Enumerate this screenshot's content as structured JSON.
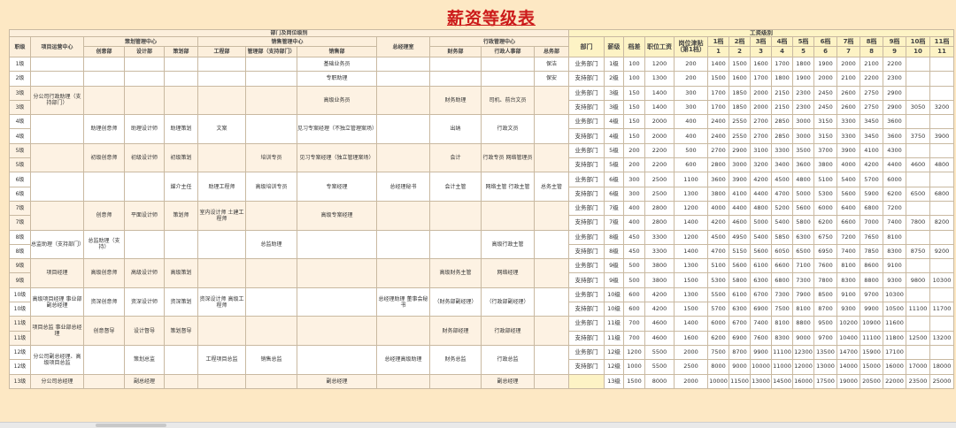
{
  "title": "薪资等级表",
  "left": {
    "group_header": "部门及岗位级别",
    "col_level": "职级",
    "col_xm": "项目运营中心",
    "col_zlb": "总经理室",
    "centers": [
      {
        "name": "策划管理中心",
        "depts": [
          "创意部",
          "设计部",
          "策划部"
        ]
      },
      {
        "name": "销售管理中心",
        "depts": [
          "工程部",
          "管理部（支持部门）",
          "销售部"
        ]
      },
      {
        "name": "行政管理中心",
        "depts": [
          "财务部",
          "行政人事部",
          "总务部"
        ]
      }
    ],
    "rows": [
      {
        "lv": "1级",
        "c": [
          "",
          "",
          "",
          "",
          "",
          "",
          "基础业务员",
          "",
          "",
          "",
          "保洁"
        ]
      },
      {
        "lv": "2级",
        "c": [
          "",
          "",
          "",
          "",
          "",
          "",
          "专职助理",
          "",
          "",
          "",
          "保安"
        ]
      },
      {
        "lv": "3级",
        "c": [
          "",
          "",
          "",
          "",
          "",
          "",
          "",
          "",
          "",
          "",
          ""
        ]
      },
      {
        "lv": "3级",
        "c": [
          "分公司行政助理（支持部门）",
          "",
          "",
          "",
          "",
          "",
          "高级业务员",
          "",
          "财务助理",
          "司机、前台文员",
          ""
        ]
      },
      {
        "lv": "4级",
        "c": [
          "",
          "",
          "",
          "",
          "",
          "",
          "",
          "",
          "",
          "",
          ""
        ]
      },
      {
        "lv": "4级",
        "c": [
          "",
          "助理创意师",
          "助理设计师",
          "助理策划",
          "文案",
          "",
          "见习专案经理（不独立管理案场）",
          "",
          "出纳",
          "行政文员",
          ""
        ]
      },
      {
        "lv": "5级",
        "c": [
          "",
          "",
          "",
          "",
          "",
          "",
          "",
          "",
          "",
          "",
          ""
        ]
      },
      {
        "lv": "5级",
        "c": [
          "",
          "初级创意师",
          "初级设计师",
          "初级策划",
          "",
          "培训专员",
          "见习专案经理（独立管理案场）",
          "",
          "会计",
          "行政专员 网络管理员",
          ""
        ]
      },
      {
        "lv": "6级",
        "c": [
          "",
          "",
          "",
          "",
          "",
          "",
          "",
          "",
          "",
          "",
          ""
        ]
      },
      {
        "lv": "6级",
        "c": [
          "",
          "",
          "",
          "媒介主任",
          "助理工程师",
          "高级培训专员",
          "专案经理",
          "总经理秘书",
          "会计主管",
          "网络主管 行政主管",
          "总务主管"
        ]
      },
      {
        "lv": "7级",
        "c": [
          "",
          "",
          "",
          "",
          "",
          "",
          "",
          "",
          "",
          "",
          ""
        ]
      },
      {
        "lv": "7级",
        "c": [
          "",
          "创意师",
          "平面设计师",
          "策划师",
          "室内设计师 土建工程师",
          "",
          "高级专案经理",
          "",
          "",
          "",
          ""
        ]
      },
      {
        "lv": "8级",
        "c": [
          "",
          "",
          "",
          "",
          "",
          "",
          "",
          "",
          "",
          "",
          ""
        ]
      },
      {
        "lv": "8级",
        "c": [
          "总监助理（支持部门）",
          "总监助理（支持）",
          "",
          "",
          "",
          "总监助理",
          "",
          "",
          "",
          "高级行政主管",
          ""
        ]
      },
      {
        "lv": "9级",
        "c": [
          "",
          "",
          "",
          "",
          "",
          "",
          "",
          "",
          "",
          "",
          ""
        ]
      },
      {
        "lv": "9级",
        "c": [
          "项目经理",
          "高级创意师",
          "高级设计师",
          "高级策划",
          "",
          "",
          "",
          "",
          "高级财务主管",
          "网络经理",
          ""
        ]
      },
      {
        "lv": "10级",
        "c": [
          "",
          "",
          "",
          "",
          "",
          "",
          "",
          "",
          "",
          "",
          ""
        ]
      },
      {
        "lv": "10级",
        "c": [
          "高级项目经理 事业部副总经理",
          "资深创意师",
          "资深设计师",
          "资深策划",
          "资深设计师 高级工程师",
          "",
          "",
          "总经理助理 董事会秘书",
          "（财务部副经理）",
          "（行政部副经理）",
          ""
        ]
      },
      {
        "lv": "11级",
        "c": [
          "",
          "",
          "",
          "",
          "",
          "",
          "",
          "",
          "",
          "",
          ""
        ]
      },
      {
        "lv": "11级",
        "c": [
          "项目总监 事业部总经理",
          "创意督导",
          "设计督导",
          "策划督导",
          "",
          "",
          "",
          "",
          "财务部经理",
          "行政部经理",
          ""
        ]
      },
      {
        "lv": "12级",
        "c": [
          "",
          "",
          "",
          "",
          "",
          "",
          "",
          "",
          "",
          "",
          ""
        ]
      },
      {
        "lv": "12级",
        "c": [
          "分公司副总经理、高级项目总监",
          "",
          "策划总监",
          "",
          "工程项目总监",
          "销售总监",
          "",
          "总经理高级助理",
          "财务总监",
          "行政总监",
          ""
        ]
      },
      {
        "lv": "13级",
        "c": [
          "分公司总经理",
          "",
          "副总经理",
          "",
          "",
          "",
          "副总经理",
          "",
          "",
          "副总经理",
          ""
        ]
      }
    ]
  },
  "right": {
    "group_header": "工资级别",
    "headers": {
      "dept": "部门",
      "level": "薪级",
      "diff": "档差",
      "base": "职位工资",
      "post": "岗位津贴（第1档）",
      "grades": [
        "1档",
        "2档",
        "3档",
        "4档",
        "5档",
        "6档",
        "7档",
        "8档",
        "9档",
        "10档",
        "11档"
      ],
      "nums": [
        "1",
        "2",
        "3",
        "4",
        "5",
        "6",
        "7",
        "8",
        "9",
        "10",
        "11"
      ]
    },
    "rows": [
      {
        "d": "业务部门",
        "lv": "1级",
        "diff": "100",
        "base": "1200",
        "post": "200",
        "g": [
          "1400",
          "1500",
          "1600",
          "1700",
          "1800",
          "1900",
          "2000",
          "2100",
          "2200",
          "",
          ""
        ]
      },
      {
        "d": "支持部门",
        "lv": "2级",
        "diff": "100",
        "base": "1300",
        "post": "200",
        "g": [
          "1500",
          "1600",
          "1700",
          "1800",
          "1900",
          "2000",
          "2100",
          "2200",
          "2300",
          "",
          ""
        ]
      },
      {
        "d": "业务部门",
        "lv": "3级",
        "diff": "150",
        "base": "1400",
        "post": "300",
        "g": [
          "1700",
          "1850",
          "2000",
          "2150",
          "2300",
          "2450",
          "2600",
          "2750",
          "2900",
          "",
          ""
        ]
      },
      {
        "d": "支持部门",
        "lv": "3级",
        "diff": "150",
        "base": "1400",
        "post": "300",
        "g": [
          "1700",
          "1850",
          "2000",
          "2150",
          "2300",
          "2450",
          "2600",
          "2750",
          "2900",
          "3050",
          "3200"
        ]
      },
      {
        "d": "业务部门",
        "lv": "4级",
        "diff": "150",
        "base": "2000",
        "post": "400",
        "g": [
          "2400",
          "2550",
          "2700",
          "2850",
          "3000",
          "3150",
          "3300",
          "3450",
          "3600",
          "",
          ""
        ]
      },
      {
        "d": "支持部门",
        "lv": "4级",
        "diff": "150",
        "base": "2000",
        "post": "400",
        "g": [
          "2400",
          "2550",
          "2700",
          "2850",
          "3000",
          "3150",
          "3300",
          "3450",
          "3600",
          "3750",
          "3900"
        ]
      },
      {
        "d": "业务部门",
        "lv": "5级",
        "diff": "200",
        "base": "2200",
        "post": "500",
        "g": [
          "2700",
          "2900",
          "3100",
          "3300",
          "3500",
          "3700",
          "3900",
          "4100",
          "4300",
          "",
          ""
        ]
      },
      {
        "d": "支持部门",
        "lv": "5级",
        "diff": "200",
        "base": "2200",
        "post": "600",
        "g": [
          "2800",
          "3000",
          "3200",
          "3400",
          "3600",
          "3800",
          "4000",
          "4200",
          "4400",
          "4600",
          "4800"
        ]
      },
      {
        "d": "业务部门",
        "lv": "6级",
        "diff": "300",
        "base": "2500",
        "post": "1100",
        "g": [
          "3600",
          "3900",
          "4200",
          "4500",
          "4800",
          "5100",
          "5400",
          "5700",
          "6000",
          "",
          ""
        ]
      },
      {
        "d": "支持部门",
        "lv": "6级",
        "diff": "300",
        "base": "2500",
        "post": "1300",
        "g": [
          "3800",
          "4100",
          "4400",
          "4700",
          "5000",
          "5300",
          "5600",
          "5900",
          "6200",
          "6500",
          "6800"
        ]
      },
      {
        "d": "业务部门",
        "lv": "7级",
        "diff": "400",
        "base": "2800",
        "post": "1200",
        "g": [
          "4000",
          "4400",
          "4800",
          "5200",
          "5600",
          "6000",
          "6400",
          "6800",
          "7200",
          "",
          ""
        ]
      },
      {
        "d": "支持部门",
        "lv": "7级",
        "diff": "400",
        "base": "2800",
        "post": "1400",
        "g": [
          "4200",
          "4600",
          "5000",
          "5400",
          "5800",
          "6200",
          "6600",
          "7000",
          "7400",
          "7800",
          "8200"
        ]
      },
      {
        "d": "业务部门",
        "lv": "8级",
        "diff": "450",
        "base": "3300",
        "post": "1200",
        "g": [
          "4500",
          "4950",
          "5400",
          "5850",
          "6300",
          "6750",
          "7200",
          "7650",
          "8100",
          "",
          ""
        ]
      },
      {
        "d": "支持部门",
        "lv": "8级",
        "diff": "450",
        "base": "3300",
        "post": "1400",
        "g": [
          "4700",
          "5150",
          "5600",
          "6050",
          "6500",
          "6950",
          "7400",
          "7850",
          "8300",
          "8750",
          "9200"
        ]
      },
      {
        "d": "业务部门",
        "lv": "9级",
        "diff": "500",
        "base": "3800",
        "post": "1300",
        "g": [
          "5100",
          "5600",
          "6100",
          "6600",
          "7100",
          "7600",
          "8100",
          "8600",
          "9100",
          "",
          ""
        ]
      },
      {
        "d": "支持部门",
        "lv": "9级",
        "diff": "500",
        "base": "3800",
        "post": "1500",
        "g": [
          "5300",
          "5800",
          "6300",
          "6800",
          "7300",
          "7800",
          "8300",
          "8800",
          "9300",
          "9800",
          "10300"
        ]
      },
      {
        "d": "业务部门",
        "lv": "10级",
        "diff": "600",
        "base": "4200",
        "post": "1300",
        "g": [
          "5500",
          "6100",
          "6700",
          "7300",
          "7900",
          "8500",
          "9100",
          "9700",
          "10300",
          "",
          ""
        ]
      },
      {
        "d": "支持部门",
        "lv": "10级",
        "diff": "600",
        "base": "4200",
        "post": "1500",
        "g": [
          "5700",
          "6300",
          "6900",
          "7500",
          "8100",
          "8700",
          "9300",
          "9900",
          "10500",
          "11100",
          "11700"
        ]
      },
      {
        "d": "业务部门",
        "lv": "11级",
        "diff": "700",
        "base": "4600",
        "post": "1400",
        "g": [
          "6000",
          "6700",
          "7400",
          "8100",
          "8800",
          "9500",
          "10200",
          "10900",
          "11600",
          "",
          ""
        ]
      },
      {
        "d": "支持部门",
        "lv": "11级",
        "diff": "700",
        "base": "4600",
        "post": "1600",
        "g": [
          "6200",
          "6900",
          "7600",
          "8300",
          "9000",
          "9700",
          "10400",
          "11100",
          "11800",
          "12500",
          "13200"
        ]
      },
      {
        "d": "业务部门",
        "lv": "12级",
        "diff": "1200",
        "base": "5500",
        "post": "2000",
        "g": [
          "7500",
          "8700",
          "9900",
          "11100",
          "12300",
          "13500",
          "14700",
          "15900",
          "17100",
          "",
          ""
        ]
      },
      {
        "d": "支持部门",
        "lv": "12级",
        "diff": "1000",
        "base": "5500",
        "post": "2500",
        "g": [
          "8000",
          "9000",
          "10000",
          "11000",
          "12000",
          "13000",
          "14000",
          "15000",
          "16000",
          "17000",
          "18000"
        ]
      },
      {
        "d": "",
        "lv": "13级",
        "diff": "1500",
        "base": "8000",
        "post": "2000",
        "g": [
          "10000",
          "11500",
          "13000",
          "14500",
          "16000",
          "17500",
          "19000",
          "20500",
          "22000",
          "23500",
          "25000"
        ]
      }
    ]
  }
}
